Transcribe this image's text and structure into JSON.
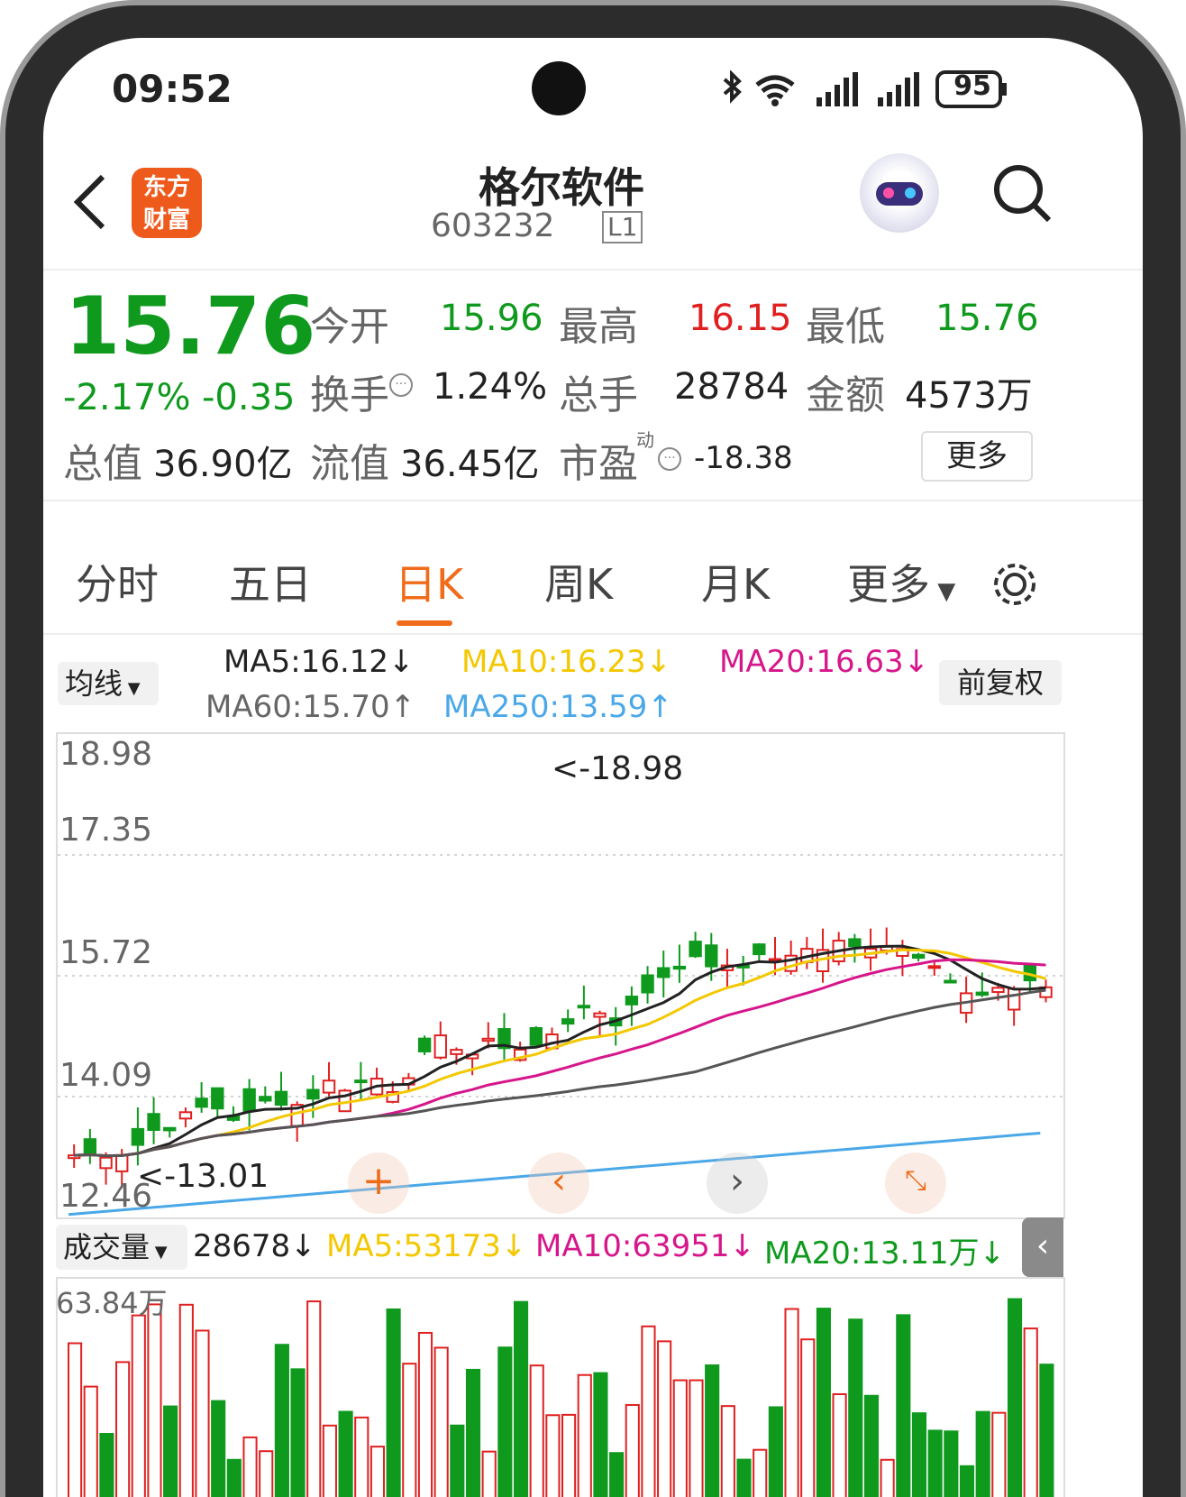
{
  "status_bar": {
    "time": "09:52",
    "battery": "95"
  },
  "header": {
    "logo_line1": "东方",
    "logo_line2": "财富",
    "stock_name": "格尔软件",
    "stock_code": "603232",
    "level_badge": "L1"
  },
  "quote": {
    "price": "15.76",
    "change_pct": "-2.17%",
    "change_amt": "-0.35",
    "open_label": "今开",
    "open": "15.96",
    "high_label": "最高",
    "high": "16.15",
    "low_label": "最低",
    "low": "15.76",
    "turnover_label": "换手",
    "turnover": "1.24%",
    "volume_label": "总手",
    "volume": "28784",
    "amount_label": "金额",
    "amount": "4573万",
    "mktcap_label": "总值",
    "mktcap": "36.90亿",
    "float_label": "流值",
    "float_cap": "36.45亿",
    "pe_label": "市盈",
    "pe_sup": "动",
    "pe": "-18.38",
    "more_label": "更多"
  },
  "tabs": [
    "分时",
    "五日",
    "日K",
    "周K",
    "月K",
    "更多"
  ],
  "ma_bar": {
    "selector": "均线",
    "ma5": "MA5:16.12↓",
    "ma10": "MA10:16.23↓",
    "ma20": "MA20:16.63↓",
    "ma60": "MA60:15.70↑",
    "ma250": "MA250:13.59↑",
    "adjust": "前复权"
  },
  "kline": {
    "y_labels": [
      "18.98",
      "17.35",
      "15.72",
      "14.09",
      "12.46"
    ],
    "max_note": "<-18.98",
    "min_note": "<-13.01"
  },
  "volume_bar": {
    "selector": "成交量",
    "vol": "28678↓",
    "ma5": "MA5:53173↓",
    "ma10": "MA10:63951↓",
    "ma20": "MA20:13.11万↓",
    "y_max": "63.84万"
  },
  "colors": {
    "up": "#e02020",
    "down": "#0f9a1e",
    "accent": "#ef6c1a",
    "ma5": "#222222",
    "ma10": "#f3c800",
    "ma20": "#d6168a",
    "ma60": "#555555",
    "ma250": "#4aa8e8"
  }
}
